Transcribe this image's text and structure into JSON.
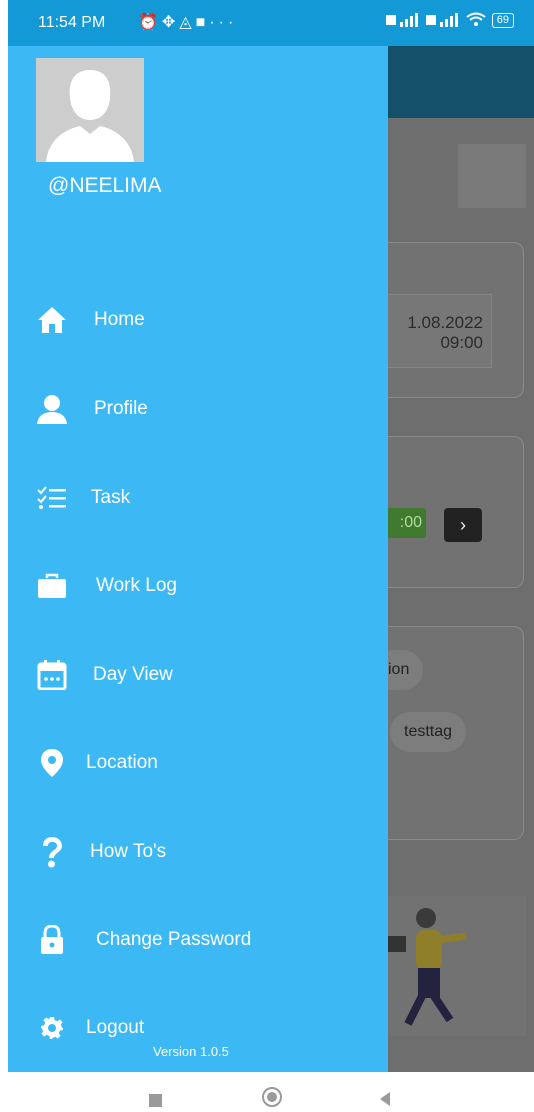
{
  "status_bar": {
    "time": "11:54 PM",
    "battery": "69"
  },
  "background": {
    "date": "1.08.2022",
    "time": "09:00",
    "timer": ":00",
    "chip_partial": "ion",
    "chip_tag": "testtag"
  },
  "drawer": {
    "username": "@NEELIMA",
    "items": [
      {
        "label": "Home",
        "icon": "home-icon"
      },
      {
        "label": "Profile",
        "icon": "person-icon"
      },
      {
        "label": "Task",
        "icon": "checklist-icon"
      },
      {
        "label": "Work Log",
        "icon": "briefcase-icon"
      },
      {
        "label": "Day View",
        "icon": "calendar-icon"
      },
      {
        "label": "Location",
        "icon": "location-pin-icon"
      },
      {
        "label": "How To's",
        "icon": "question-icon"
      },
      {
        "label": "Change Password",
        "icon": "lock-icon"
      },
      {
        "label": "Logout",
        "icon": "gear-icon"
      }
    ],
    "version": "Version 1.0.5"
  },
  "colors": {
    "drawer": "#3cb9f5",
    "status_bar": "#139ad6"
  }
}
